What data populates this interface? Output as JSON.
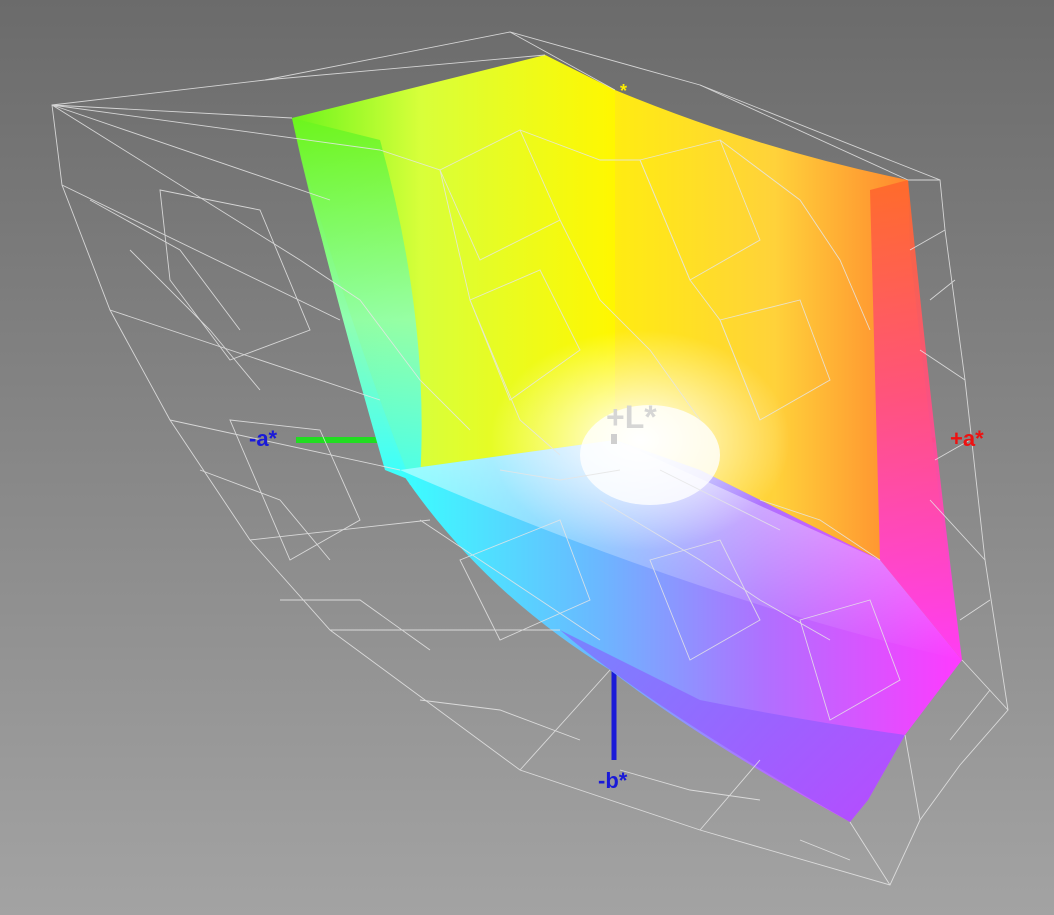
{
  "axes": {
    "neg_a": {
      "label": "-a*",
      "color": "#1a1ad8",
      "line_color": "#22dd22"
    },
    "pos_a": {
      "label": "+a*",
      "color": "#ee1111",
      "line_color": "#ee1111"
    },
    "neg_b": {
      "label": "-b*",
      "color": "#1a1ad8",
      "line_color": "#1a1ad8"
    },
    "pos_b": {
      "label": "*",
      "color": "#ffee00"
    },
    "pos_l": {
      "label": "+L*",
      "color": "#d4d4d4"
    }
  },
  "colors": {
    "background_top": "#6b6b6b",
    "background_bottom": "#a3a3a3",
    "wireframe": "#e6e6e6",
    "green": "#6cf51c",
    "yellow": "#fff700",
    "orange": "#ff7a2a",
    "red": "#ff3a6e",
    "magenta": "#ff3aff",
    "violet": "#a04aff",
    "blue": "#5a8cff",
    "cyan": "#3affff",
    "white": "#ffffff"
  }
}
